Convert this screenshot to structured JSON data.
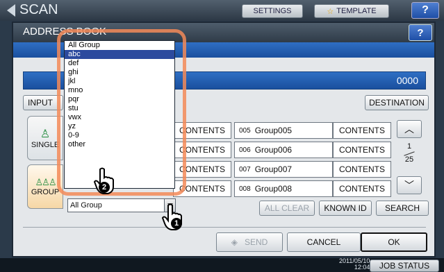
{
  "header": {
    "title": "SCAN",
    "settings_label": "SETTINGS",
    "template_label": "TEMPLATE",
    "help_label": "?"
  },
  "dialog": {
    "title": "ADDRESS BOOK",
    "help_label": "?",
    "count": "0000",
    "input_label": "INPUT",
    "destination_label": "DESTINATION"
  },
  "tabs": [
    {
      "label": "SINGLE"
    },
    {
      "label": "GROUP"
    }
  ],
  "rows": [
    {
      "left_contents": "CONTENTS",
      "num": "005",
      "name": "Group005",
      "contents": "CONTENTS"
    },
    {
      "left_contents": "CONTENTS",
      "num": "006",
      "name": "Group006",
      "contents": "CONTENTS"
    },
    {
      "left_contents": "CONTENTS",
      "num": "007",
      "name": "Group007",
      "contents": "CONTENTS"
    },
    {
      "left_contents": "CONTENTS",
      "num": "008",
      "name": "Group008",
      "contents": "CONTENTS"
    }
  ],
  "pager": {
    "current": "1",
    "total": "25"
  },
  "dropdown": {
    "options": [
      "All Group",
      "abc",
      "def",
      "ghi",
      "jkl",
      "mno",
      "pqr",
      "stu",
      "vwx",
      "yz",
      "0-9",
      "other"
    ],
    "selected_index": 1,
    "current_value": "All Group"
  },
  "actions": {
    "all_clear": "ALL CLEAR",
    "known_id": "KNOWN ID",
    "search": "SEARCH",
    "send": "SEND",
    "cancel": "CANCEL",
    "ok": "OK"
  },
  "callouts": {
    "step1": "1",
    "step2": "2"
  },
  "status": {
    "date": "2011/05/10",
    "time": "12:04",
    "job_status": "JOB STATUS"
  },
  "colors": {
    "accent_blue": "#1f4fa6",
    "highlight": "#f38a58",
    "selected_option": "#2c4a9e"
  }
}
